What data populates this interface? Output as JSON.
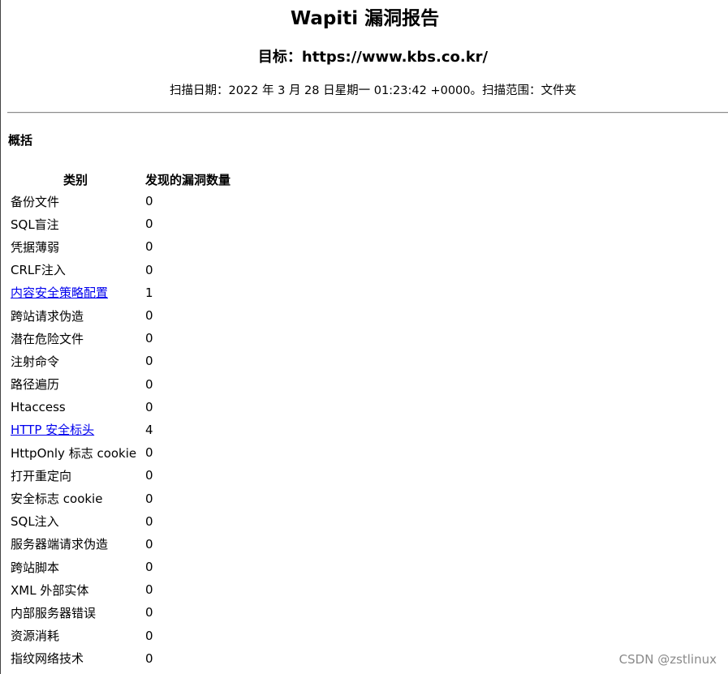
{
  "report": {
    "title": "Wapiti 漏洞报告",
    "target": "目标：https://www.kbs.co.kr/",
    "scan_info": "扫描日期：2022 年 3 月 28 日星期一 01:23:42 +0000。扫描范围：文件夹"
  },
  "overview": {
    "heading": "概括",
    "columns": [
      "类别",
      "发现的漏洞数量"
    ],
    "rows": [
      {
        "category": "备份文件",
        "count": "0",
        "link": false
      },
      {
        "category": "SQL盲注",
        "count": "0",
        "link": false
      },
      {
        "category": "凭据薄弱",
        "count": "0",
        "link": false
      },
      {
        "category": "CRLF注入",
        "count": "0",
        "link": false
      },
      {
        "category": "内容安全策略配置",
        "count": "1",
        "link": true
      },
      {
        "category": "跨站请求伪造",
        "count": "0",
        "link": false
      },
      {
        "category": "潜在危险文件",
        "count": "0",
        "link": false
      },
      {
        "category": "注射命令",
        "count": "0",
        "link": false
      },
      {
        "category": "路径遍历",
        "count": "0",
        "link": false
      },
      {
        "category": "Htaccess",
        "count": "0",
        "link": false
      },
      {
        "category": "HTTP 安全标头",
        "count": "4",
        "link": true
      },
      {
        "category": "HttpOnly 标志 cookie",
        "count": "0",
        "link": false
      },
      {
        "category": "打开重定向",
        "count": "0",
        "link": false
      },
      {
        "category": "安全标志 cookie",
        "count": "0",
        "link": false
      },
      {
        "category": "SQL注入",
        "count": "0",
        "link": false
      },
      {
        "category": "服务器端请求伪造",
        "count": "0",
        "link": false
      },
      {
        "category": "跨站脚本",
        "count": "0",
        "link": false
      },
      {
        "category": "XML 外部实体",
        "count": "0",
        "link": false
      },
      {
        "category": "内部服务器错误",
        "count": "0",
        "link": false
      },
      {
        "category": "资源消耗",
        "count": "0",
        "link": false
      },
      {
        "category": "指纹网络技术",
        "count": "0",
        "link": false
      }
    ]
  },
  "watermark": "CSDN @zstlinux",
  "colors": {
    "link": "#0000ee",
    "divider": "#8c8c8c",
    "watermark": "#8a8a8a"
  }
}
